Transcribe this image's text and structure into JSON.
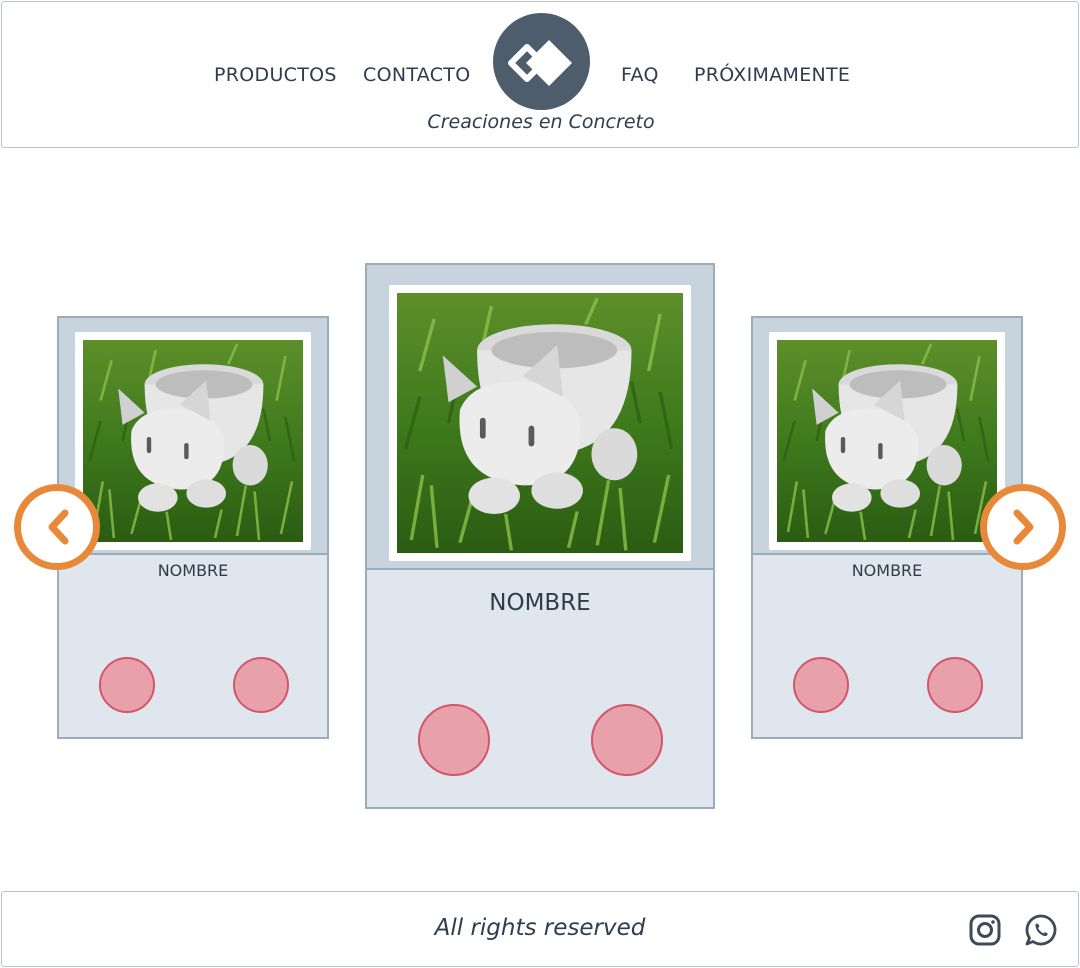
{
  "header": {
    "nav_left": [
      "PRODUCTOS",
      "CONTACTO"
    ],
    "nav_right": [
      "FAQ",
      "PRÓXIMAMENTE"
    ],
    "tagline": "Creaciones en Concreto"
  },
  "carousel": {
    "cards": [
      {
        "name": "NOMBRE",
        "photo": "concrete-cat-planter"
      },
      {
        "name": "NOMBRE",
        "photo": "concrete-cat-planter"
      },
      {
        "name": "NOMBRE",
        "photo": "concrete-cat-planter"
      }
    ],
    "prev_icon": "chevron-left-icon",
    "next_icon": "chevron-right-icon"
  },
  "footer": {
    "text": "All rights reserved",
    "icons": [
      "instagram-icon",
      "whatsapp-icon"
    ]
  },
  "colors": {
    "arrow": "#e8893a",
    "dot_fill": "#e8a0ab",
    "dot_border": "#d3566d",
    "card_bg": "#e0e6ee",
    "photo_frame": "#c7d3dd",
    "logo": "#4d5d6b"
  }
}
